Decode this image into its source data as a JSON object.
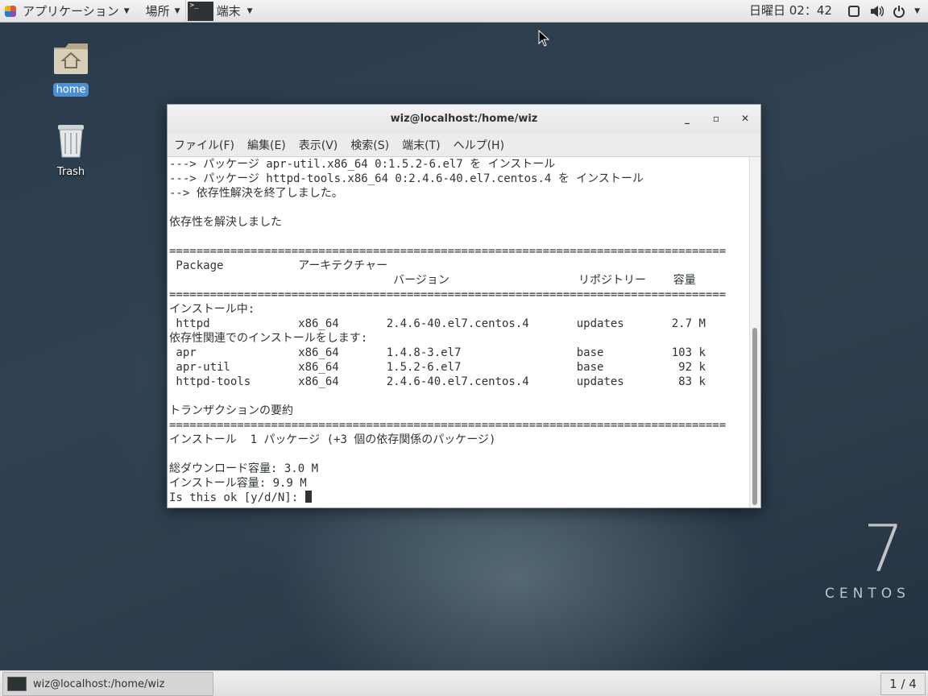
{
  "top_panel": {
    "applications": "アプリケーション",
    "places": "場所",
    "terminal_task": "端末",
    "clock": "日曜日 02：42"
  },
  "desktop": {
    "icons": [
      {
        "label": "home"
      },
      {
        "label": "Trash"
      }
    ],
    "brand_number": "7",
    "brand_name": "CENTOS"
  },
  "window": {
    "title": "wiz@localhost:/home/wiz",
    "menu": [
      "ファイル(F)",
      "編集(E)",
      "表示(V)",
      "検索(S)",
      "端末(T)",
      "ヘルプ(H)"
    ],
    "terminal_lines": [
      "---> パッケージ apr-util.x86_64 0:1.5.2-6.el7 を インストール",
      "---> パッケージ httpd-tools.x86_64 0:2.4.6-40.el7.centos.4 を インストール",
      "--> 依存性解決を終了しました。",
      "",
      "依存性を解決しました",
      "",
      "==================================================================================",
      " Package           アーキテクチャー",
      "                                 バージョン                   リポジトリー    容量",
      "==================================================================================",
      "インストール中:",
      " httpd             x86_64       2.4.6-40.el7.centos.4       updates       2.7 M",
      "依存性関連でのインストールをします:",
      " apr               x86_64       1.4.8-3.el7                 base          103 k",
      " apr-util          x86_64       1.5.2-6.el7                 base           92 k",
      " httpd-tools       x86_64       2.4.6-40.el7.centos.4       updates        83 k",
      "",
      "トランザクションの要約",
      "==================================================================================",
      "インストール  1 パッケージ (+3 個の依存関係のパッケージ)",
      "",
      "総ダウンロード容量: 3.0 M",
      "インストール容量: 9.9 M"
    ],
    "prompt": "Is this ok [y/d/N]: "
  },
  "bottom_panel": {
    "task_label": "wiz@localhost:/home/wiz",
    "workspace": "1 / 4"
  },
  "colors": {
    "selection": "#4a90d9",
    "terminal_fg": "#2e3436",
    "desktop_bg": "#2c3d4c"
  }
}
